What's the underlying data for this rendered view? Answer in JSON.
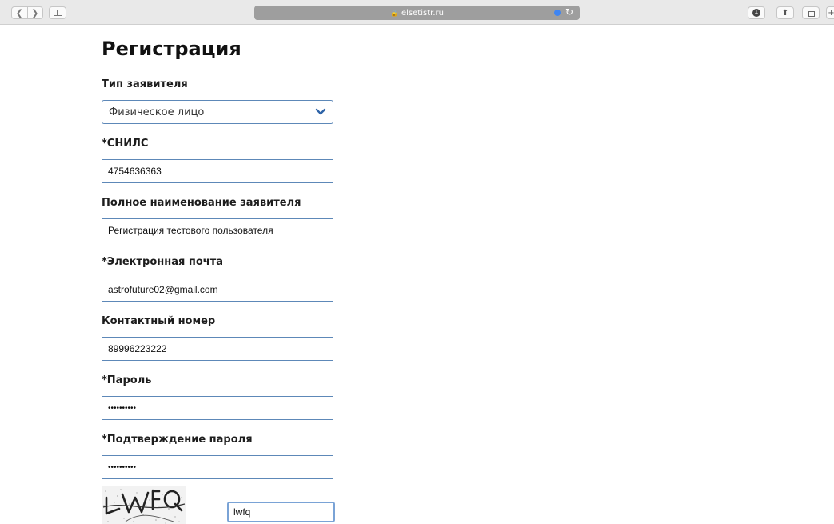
{
  "browser": {
    "url": "elsetistr.ru",
    "back_icon": "chevron-left-icon",
    "forward_icon": "chevron-right-icon"
  },
  "form": {
    "title": "Регистрация",
    "applicant_type": {
      "label": "Тип заявителя",
      "value": "Физическое лицо"
    },
    "snils": {
      "label": "*СНИЛС",
      "value": "4754636363"
    },
    "full_name": {
      "label": "Полное наименование заявителя",
      "value": "Регистрация тестового пользователя"
    },
    "email": {
      "label": "*Электронная почта",
      "value": "astrofuture02@gmail.com"
    },
    "phone": {
      "label": "Контактный номер",
      "value": "89996223222"
    },
    "password": {
      "label": "*Пароль",
      "value": "••••••••••"
    },
    "password_confirm": {
      "label": "*Подтверждение пароля",
      "value": "••••••••••"
    },
    "captcha": {
      "value": "lwfq"
    }
  },
  "colors": {
    "input_border": "#5d88b8",
    "chevron": "#2e64a8",
    "focus_border": "#7aa3d6"
  }
}
